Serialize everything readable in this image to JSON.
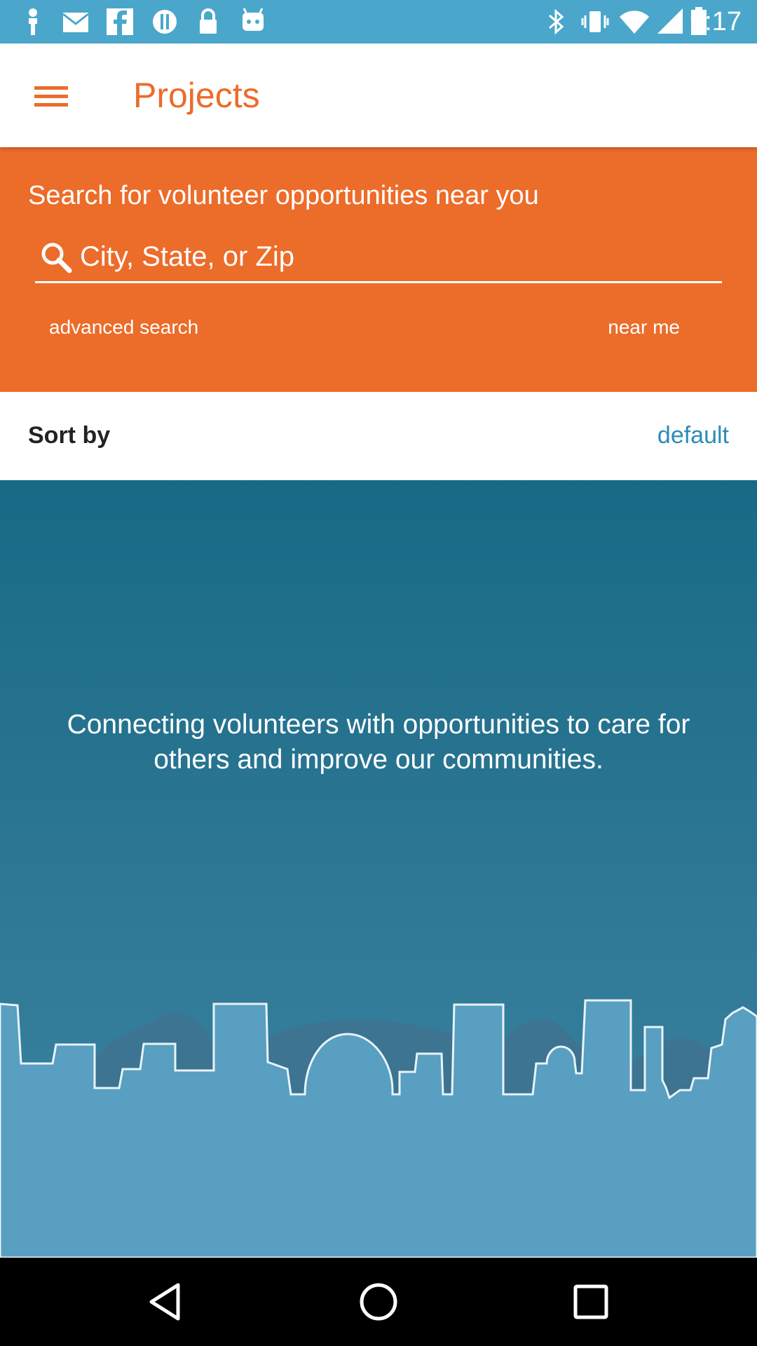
{
  "status_bar": {
    "time": "9:17",
    "left_icons": [
      "notification-icon",
      "mail-icon",
      "facebook-icon",
      "info-icon",
      "lock-icon",
      "android-icon"
    ],
    "right_icons": [
      "bluetooth-icon",
      "vibrate-icon",
      "wifi-icon",
      "signal-icon",
      "battery-icon"
    ]
  },
  "app_bar": {
    "title": "Projects",
    "menu_icon": "hamburger-menu-icon"
  },
  "search_panel": {
    "heading": "Search for volunteer opportunities near you",
    "input_placeholder": "City, State, or Zip",
    "input_value": "",
    "advanced_search": "advanced search",
    "near_me": "near me"
  },
  "sort": {
    "label": "Sort by",
    "value": "default"
  },
  "hero": {
    "tagline": "Connecting volunteers with opportunities to care for others and improve our communities."
  },
  "nav_bar": {
    "buttons": [
      "back-icon",
      "home-icon",
      "recents-icon"
    ]
  },
  "colors": {
    "brand_orange": "#ec6c2a",
    "status_bar": "#4aa7cb",
    "link_blue": "#2c8bb7",
    "hero_top": "#176a85",
    "skyline_light": "#589fc1",
    "skyline_dark": "#3c7492"
  }
}
